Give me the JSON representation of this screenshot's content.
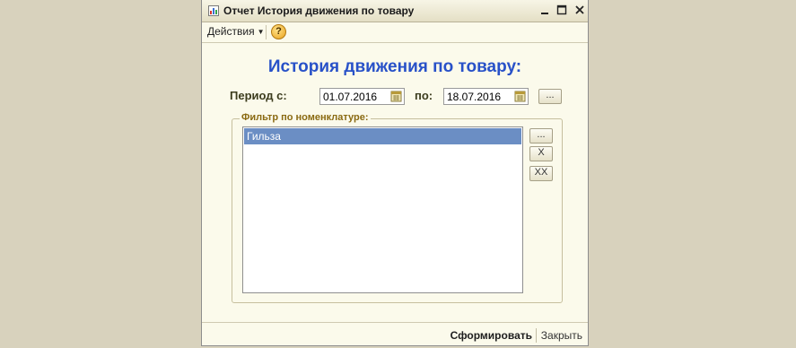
{
  "window": {
    "title": "Отчет  История движения по товару",
    "controls": [
      "minimize-icon",
      "maximize-icon",
      "close-icon"
    ]
  },
  "toolbar": {
    "actions_label": "Действия",
    "help_label": "?"
  },
  "report": {
    "heading": "История движения по товару:"
  },
  "period": {
    "from_label": "Период с:",
    "from_value": "01.07.2016",
    "to_label": "по:",
    "to_value": "18.07.2016",
    "select_button_label": "..."
  },
  "filter": {
    "legend": "Фильтр по номенклатуре:",
    "items": [
      {
        "label": "Гильза",
        "selected": true
      }
    ],
    "add_button_label": "...",
    "remove_button_label": "X",
    "clear_button_label": "XX"
  },
  "footer": {
    "generate_label": "Сформировать",
    "close_label": "Закрыть"
  },
  "colors": {
    "heading": "#2851c8",
    "selection": "#6b8ec4",
    "background": "#d8d2bd",
    "window_bg": "#fbfaeb"
  }
}
